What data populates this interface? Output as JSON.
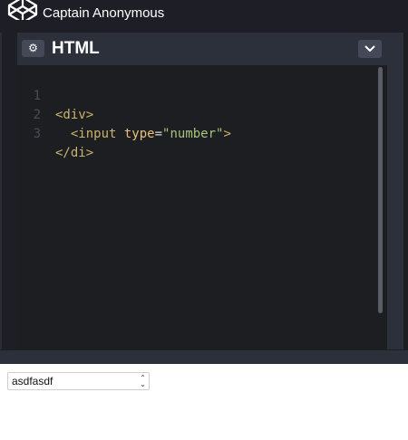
{
  "header": {
    "author": "Captain Anonymous"
  },
  "editor": {
    "title": "HTML",
    "lines": [
      {
        "number": "1",
        "indent": "",
        "open": "<div>",
        "attr": "",
        "eq": "",
        "value": "",
        "close": ""
      },
      {
        "number": "2",
        "indent": "  ",
        "open": "<input ",
        "attr": "type",
        "eq": "=",
        "value": "\"number\"",
        "close": ">"
      },
      {
        "number": "3",
        "indent": "",
        "open": "</di>",
        "attr": "",
        "eq": "",
        "value": "",
        "close": ""
      }
    ]
  },
  "preview": {
    "input_value": "asdfasdf"
  },
  "colors": {
    "background": "#1e1f26",
    "editor_bg": "#1d1e22",
    "panel_header": "#2c303a",
    "button_bg": "#444857",
    "tag": "#c9b26c",
    "string": "#a6c37f"
  }
}
